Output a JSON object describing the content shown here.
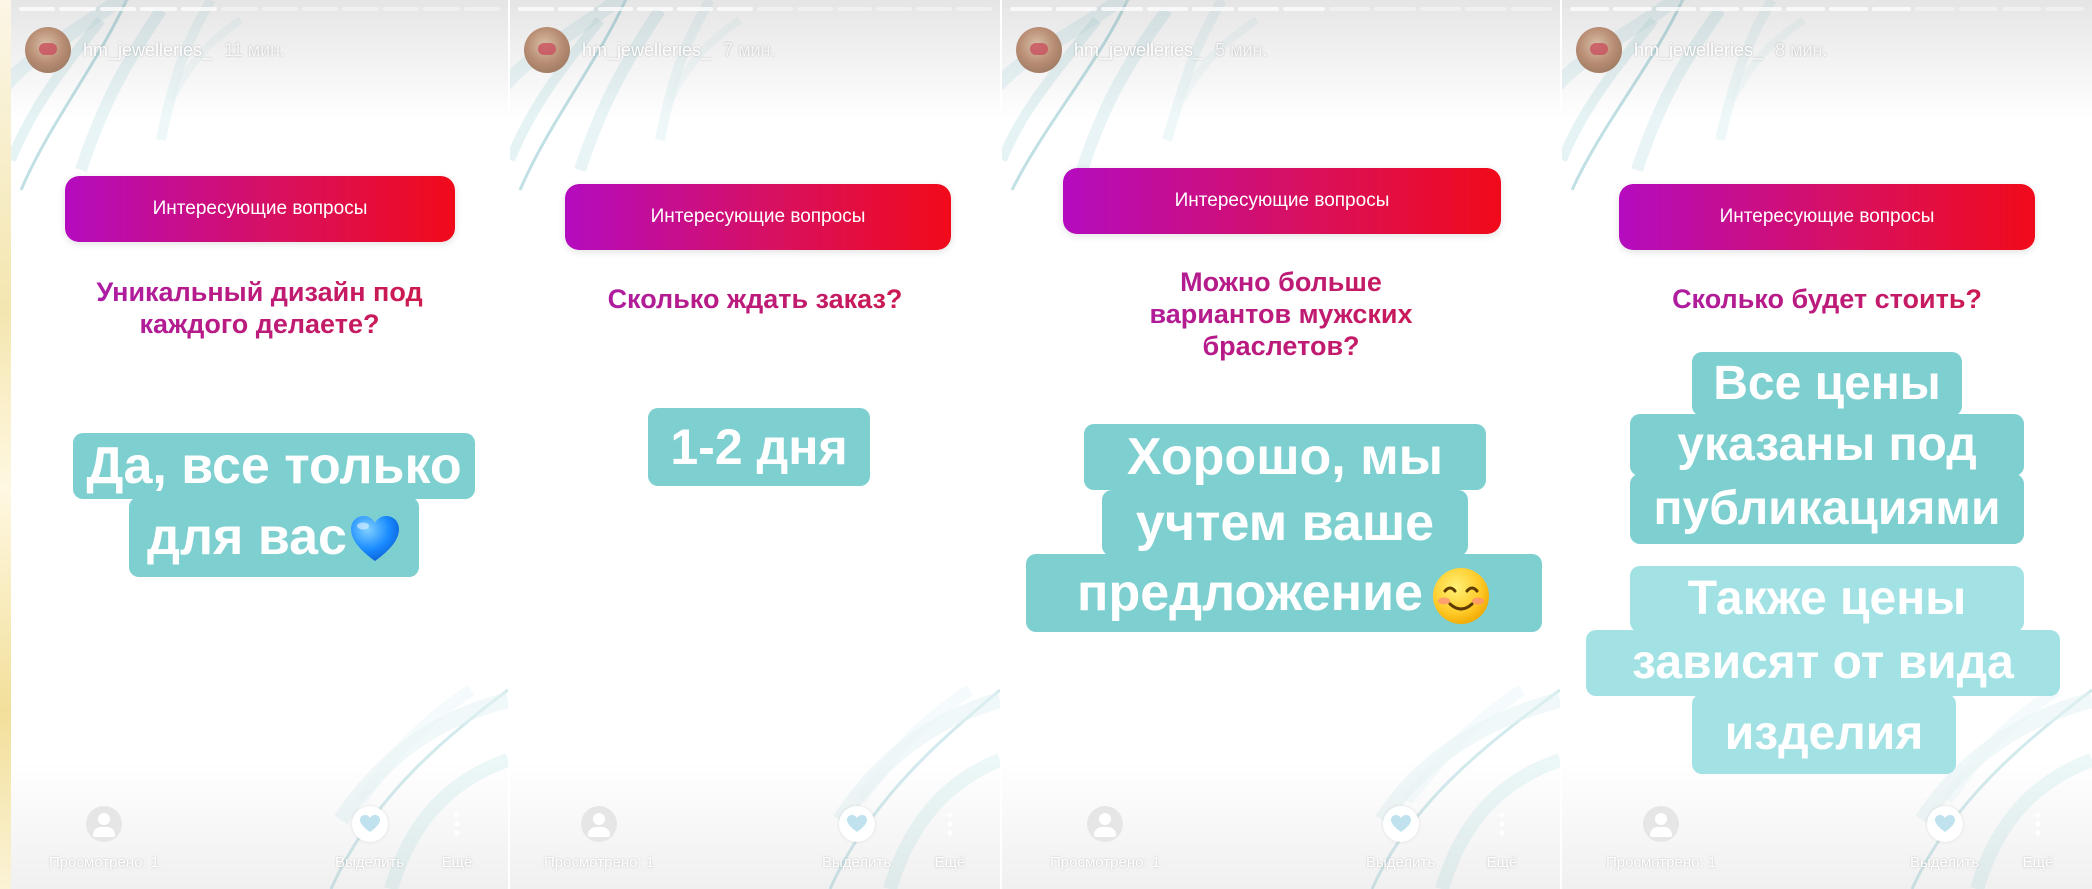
{
  "stories": [
    {
      "username": "hm_jewelleries_",
      "time": "11 мин.",
      "question_header": "Интересующие вопросы",
      "question": [
        "Уникальный дизайн под",
        "каждого делаете?"
      ],
      "answer": [
        "Да, все только",
        "для вас"
      ],
      "answer_emoji": "blue-heart-emoji",
      "viewers_label": "Просмотрено: 1",
      "highlight_label": "Выделить",
      "more_label": "Ещё"
    },
    {
      "username": "hm_jewelleries_",
      "time": "7 мин.",
      "question_header": "Интересующие вопросы",
      "question": [
        "Сколько ждать заказ?"
      ],
      "answer": [
        "1-2 дня"
      ],
      "viewers_label": "Просмотрено: 1",
      "highlight_label": "Выделить",
      "more_label": "Ещё"
    },
    {
      "username": "hm_jewelleries_",
      "time": "5 мин.",
      "question_header": "Интересующие вопросы",
      "question": [
        "Можно больше",
        "вариантов мужских",
        "браслетов?"
      ],
      "answer": [
        "Хорошо,  мы",
        "учтем ваше",
        "предложение"
      ],
      "answer_emoji": "smiling-face-emoji",
      "viewers_label": "Просмотрено: 1",
      "highlight_label": "Выделить",
      "more_label": "Ещё"
    },
    {
      "username": "hm_jewelleries_",
      "time": "8 мин.",
      "question_header": "Интересующие вопросы",
      "question": [
        "Сколько будет стоить?"
      ],
      "answer": [
        "Все цены",
        "указаны под",
        "публикациями"
      ],
      "answer2": [
        "Также цены",
        "зависят от вида",
        "изделия"
      ],
      "viewers_label": "Просмотрено: 1",
      "highlight_label": "Выделить",
      "more_label": "Ещё"
    }
  ],
  "colors": {
    "question_gradient_start": "#b40bbf",
    "question_gradient_end": "#f10a1a",
    "answer_bg": "#7ecfd0"
  }
}
